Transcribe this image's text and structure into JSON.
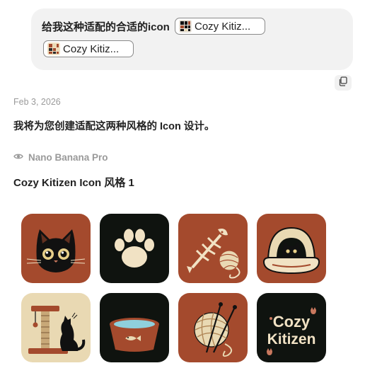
{
  "user_message": {
    "text": "给我这种适配的合适的icon",
    "attachments": [
      {
        "label": "Cozy Kitiz...",
        "thumbnail_icon": "dark-cat-image-thumbnail"
      },
      {
        "label": "Cozy Kitiz...",
        "thumbnail_icon": "warm-cat-image-thumbnail"
      }
    ]
  },
  "copy_icon": "copy-icon",
  "response": {
    "date": "Feb 3, 2026",
    "intro": "我将为您创建适配这两种风格的 Icon 设计。",
    "model_name": "Nano Banana Pro",
    "model_icon": "eye-icon",
    "heading": "Cozy Kitizen Icon 风格 1"
  },
  "icon_sheet": {
    "colors": {
      "rust": "#a44a2d",
      "black": "#0f130f",
      "cream": "#f1e2c4",
      "sand": "#e9d9b3"
    },
    "tiles": [
      {
        "name": "cat-face-icon"
      },
      {
        "name": "paw-print-icon"
      },
      {
        "name": "fish-bone-yarn-icon"
      },
      {
        "name": "cat-bed-icon"
      },
      {
        "name": "scratching-post-icon"
      },
      {
        "name": "food-bowl-icon"
      },
      {
        "name": "yarn-needles-icon"
      },
      {
        "name": "logo-text-icon",
        "text": [
          "Cozy",
          "Kitizen"
        ]
      }
    ]
  }
}
